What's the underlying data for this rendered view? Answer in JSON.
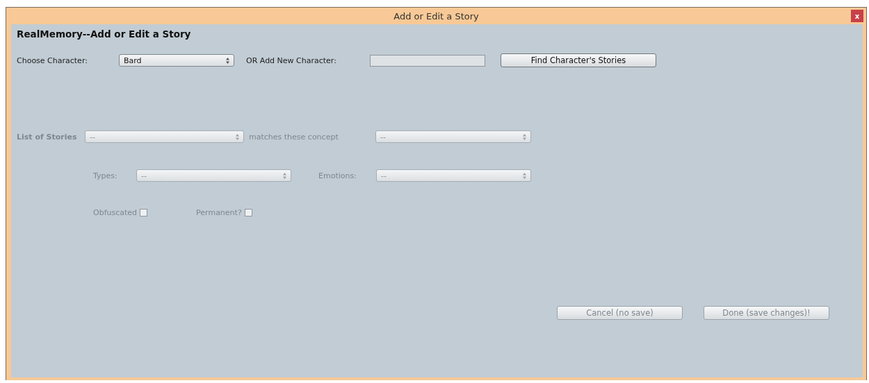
{
  "window": {
    "title": "Add or Edit a Story",
    "close": "x"
  },
  "heading": "RealMemory--Add or Edit a Story",
  "character_row": {
    "label": "Choose Character:",
    "select": {
      "value": "Bard",
      "disabled": false
    },
    "new_label": "OR Add New Character:",
    "new_field": {
      "disabled": false
    },
    "button": {
      "label": "Find Character's Stories",
      "disabled": false
    }
  },
  "stories_row": {
    "label": "List of Stories",
    "select": {
      "value": "--",
      "disabled": true
    },
    "concepts_label": "matches these concept",
    "concepts_select": {
      "value": "--",
      "disabled": true
    }
  },
  "types_row": {
    "label": "Types:",
    "select": {
      "value": "--",
      "disabled": true
    },
    "emotions_label": "Emotions:",
    "emotions_select": {
      "value": "--",
      "disabled": true
    }
  },
  "checkboxes": [
    {
      "label": "Obfuscated",
      "checked": false,
      "disabled": true
    },
    {
      "label": "Permanent?",
      "checked": false,
      "disabled": true
    }
  ],
  "buttons": [
    {
      "label": "Cancel (no save)",
      "disabled": true
    },
    {
      "label": "Done (save changes)!",
      "disabled": true
    }
  ]
}
